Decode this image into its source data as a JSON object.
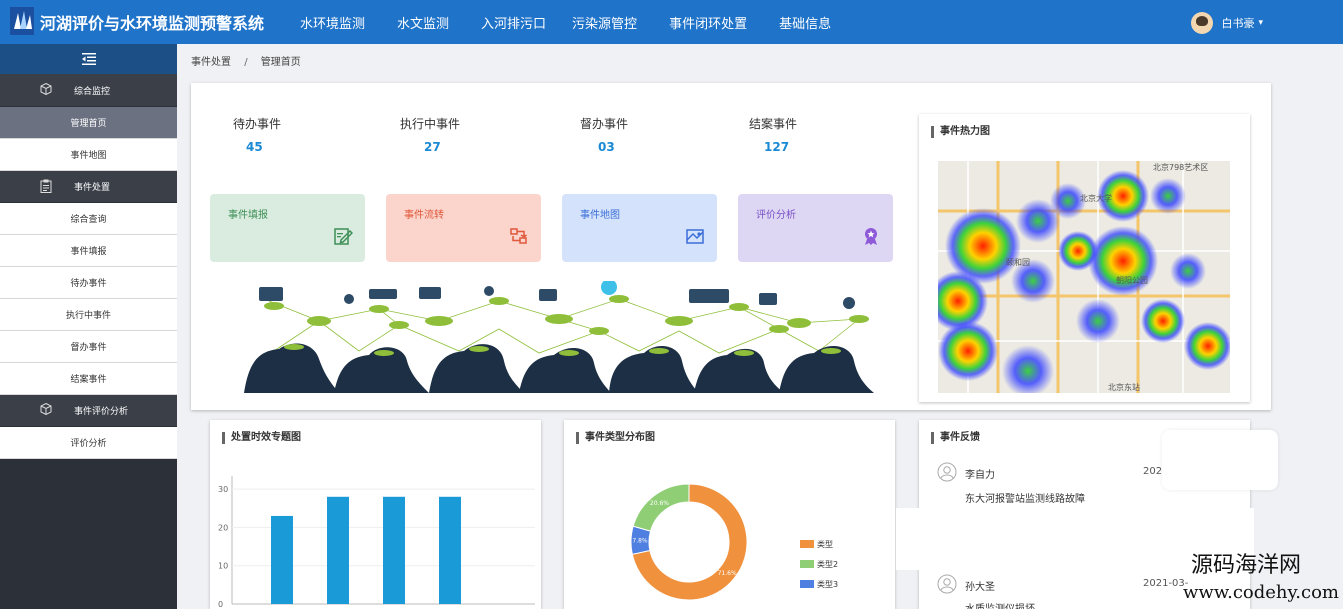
{
  "app": {
    "title": "河湖评价与水环境监测预警系统"
  },
  "nav": {
    "items": [
      "水环境监测",
      "水文监测",
      "入河排污口",
      "污染源管控",
      "事件闭环处置",
      "基础信息"
    ]
  },
  "user": {
    "name": "白书豪",
    "caret": "▾"
  },
  "sidebar": {
    "toggle_icon": "menu-collapse-icon",
    "groups": [
      {
        "label": "综合监控",
        "icon": "cube-icon",
        "items": [
          "管理首页",
          "事件地图"
        ]
      },
      {
        "label": "事件处置",
        "icon": "clipboard-icon",
        "items": [
          "综合查询",
          "事件填报",
          "待办事件",
          "执行中事件",
          "督办事件",
          "结案事件"
        ]
      },
      {
        "label": "事件评价分析",
        "icon": "cube-icon",
        "items": [
          "评价分析"
        ]
      }
    ],
    "active_item": "管理首页"
  },
  "breadcrumb": {
    "parent": "事件处置",
    "separator": "/",
    "current": "管理首页"
  },
  "stats": [
    {
      "label": "待办事件",
      "value": "45"
    },
    {
      "label": "执行中事件",
      "value": "27"
    },
    {
      "label": "督办事件",
      "value": "03"
    },
    {
      "label": "结案事件",
      "value": "127"
    }
  ],
  "tiles": [
    {
      "label": "事件填报",
      "bg": "#d9ecdf",
      "fg": "#3f8f57",
      "icon": "edit-icon"
    },
    {
      "label": "事件流转",
      "bg": "#fbd5cc",
      "fg": "#e0573a",
      "icon": "flow-icon"
    },
    {
      "label": "事件地图",
      "bg": "#d5e2fb",
      "fg": "#3a6ed8",
      "icon": "map-icon"
    },
    {
      "label": "评价分析",
      "bg": "#ddd7f3",
      "fg": "#7a4fc8",
      "icon": "medal-icon"
    }
  ],
  "heatmap": {
    "title": "事件热力图",
    "map_labels": [
      "北京798艺术区",
      "北京大学",
      "颐和园",
      "朝阳公园",
      "北京东站"
    ]
  },
  "bar_card": {
    "title": "处置时效专题图",
    "chart_data": {
      "type": "bar",
      "categories": [
        "",
        "",
        "",
        ""
      ],
      "values": [
        23,
        28,
        28,
        28
      ],
      "title": "",
      "xlabel": "",
      "ylabel": "",
      "ylim": [
        0,
        35
      ],
      "yticks": [
        "0",
        "10",
        "20",
        "30"
      ],
      "color": "#1a9ad6"
    }
  },
  "pie_card": {
    "title": "事件类型分布图",
    "chart_data": {
      "type": "pie",
      "categories": [
        "类型",
        "类型2",
        "类型3"
      ],
      "values": [
        71.6,
        20.6,
        7.8
      ],
      "labels": [
        "71.6%",
        "20.6%",
        "7.8%"
      ],
      "colors": [
        "#f0913d",
        "#8fce75",
        "#4f7fe0"
      ],
      "donut": true
    }
  },
  "feedback": {
    "title": "事件反馈",
    "items": [
      {
        "name": "李自力",
        "date": "202",
        "text": "东大河报警站监测线路故障"
      },
      {
        "name": "孙大圣",
        "date": "2021-03-",
        "text": "水质监测仪损坏"
      }
    ]
  },
  "watermark": {
    "line1": "源码海洋网",
    "line2": "www.codehy.com"
  }
}
